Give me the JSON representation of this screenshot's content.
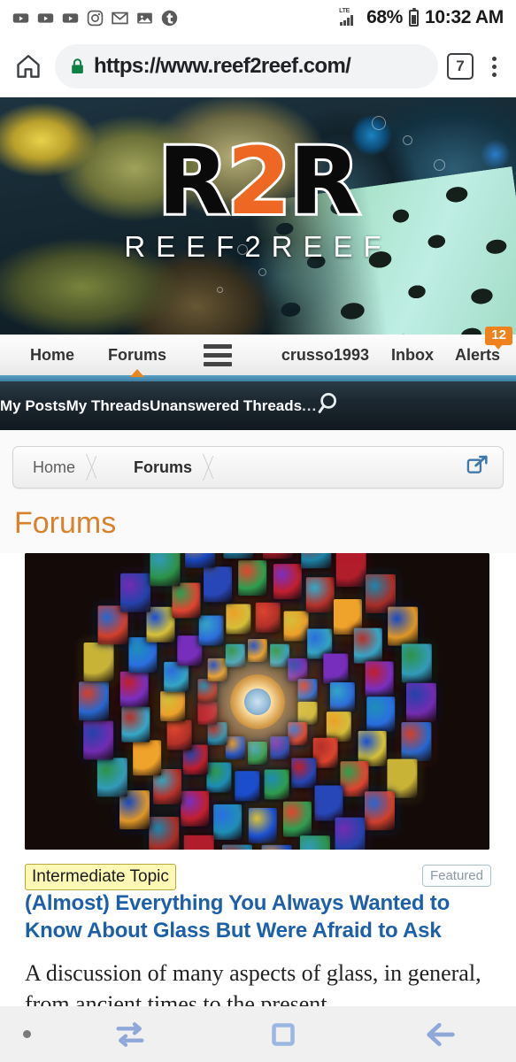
{
  "status_bar": {
    "notification_icons": [
      "youtube-icon",
      "youtube-icon",
      "youtube-icon",
      "instagram-icon",
      "mail-icon",
      "photos-icon",
      "tumblr-icon"
    ],
    "network_type": "LTE",
    "battery_percent": "68%",
    "clock": "10:32 AM"
  },
  "browser": {
    "home_icon": "home-icon",
    "lock_icon": "lock-icon",
    "url": "https://www.reef2reef.com/",
    "tab_count": "7",
    "menu_icon": "kebab-menu-icon"
  },
  "site_header": {
    "logo_part1": "R",
    "logo_part2": "2",
    "logo_part3": "R",
    "logo_subtitle": "REEF2REEF"
  },
  "main_nav": {
    "items": [
      {
        "label": "Home",
        "active": false
      },
      {
        "label": "Forums",
        "active": true
      }
    ],
    "menu_icon": "hamburger-menu-icon",
    "username": "crusso1993",
    "inbox_label": "Inbox",
    "alerts_label": "Alerts",
    "alerts_count": "12"
  },
  "sub_nav": {
    "items": [
      "My Posts",
      "My Threads",
      "Unanswered Threads",
      "..."
    ],
    "search_icon": "search-icon"
  },
  "breadcrumb": {
    "items": [
      {
        "label": "Home",
        "current": false
      },
      {
        "label": "Forums",
        "current": true
      }
    ],
    "external_link_icon": "external-link-icon"
  },
  "page": {
    "title": "Forums"
  },
  "featured_article": {
    "image_alt": "stained-glass-rose-window",
    "topic_badge": "Intermediate Topic",
    "title": "(Almost) Everything You Always Wanted to Know About Glass But Were Afraid to Ask",
    "featured_tag": "Featured",
    "description": "A discussion of many aspects of glass, in general, from ancient times to the present"
  },
  "android_nav": {
    "buttons": [
      "dot-indicator",
      "recents-icon",
      "home-square-icon",
      "back-arrow-icon"
    ]
  },
  "colors": {
    "brand_orange": "#ef6823",
    "nav_active_orange": "#e07c19",
    "page_title_orange": "#d9822b",
    "link_blue": "#1d5fa8",
    "badge_orange": "#f0821e",
    "nav_underline_blue": "#57a0c4",
    "subnav_dark": "#1c2831",
    "lock_green": "#0f8043",
    "topic_badge_yellow": "#fdf9b5"
  }
}
